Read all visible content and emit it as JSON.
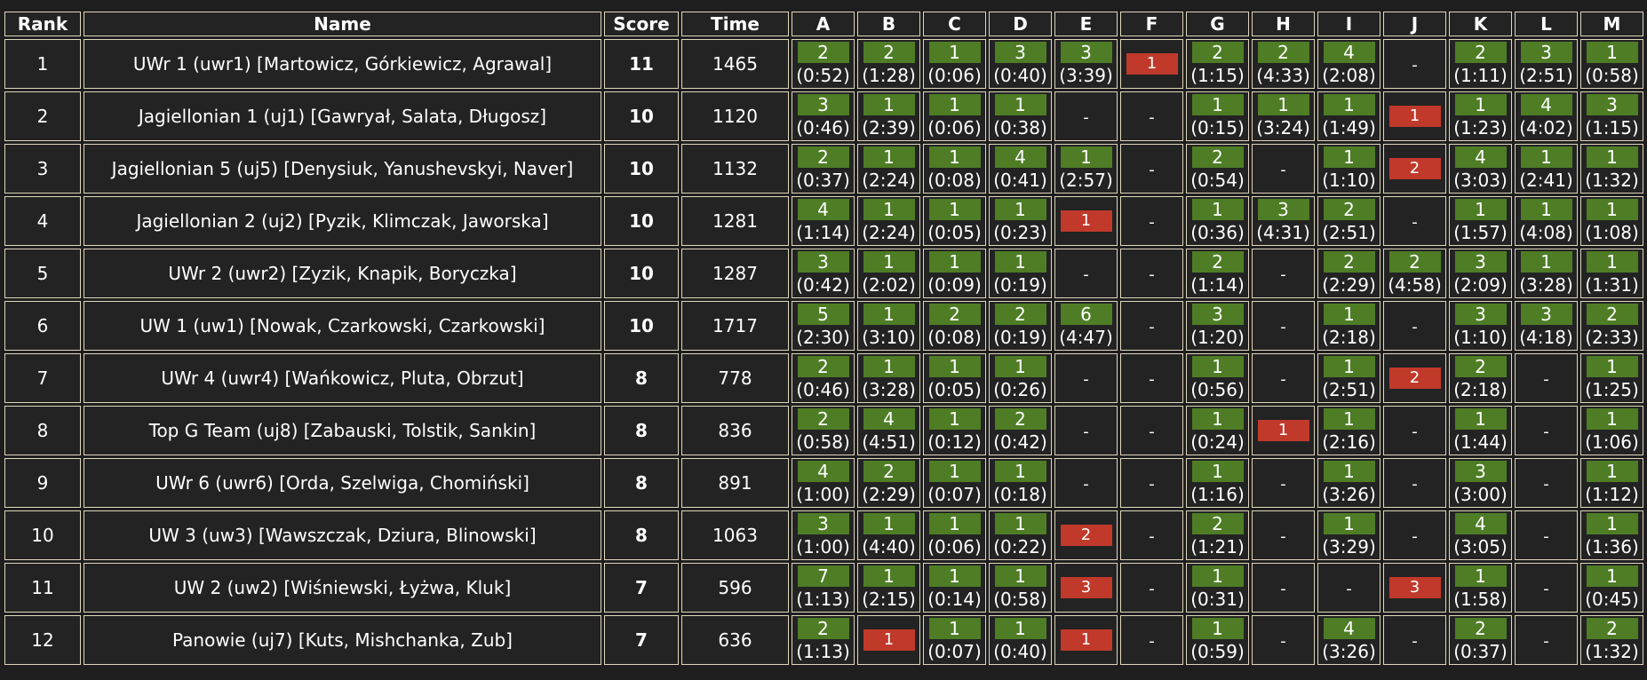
{
  "headers": {
    "rank": "Rank",
    "name": "Name",
    "score": "Score",
    "time": "Time",
    "problems": [
      "A",
      "B",
      "C",
      "D",
      "E",
      "F",
      "G",
      "H",
      "I",
      "J",
      "K",
      "L",
      "M"
    ]
  },
  "colors": {
    "solved": "#4e7d25",
    "failed": "#c0392b",
    "background": "#232323",
    "border": "#e0d6bd"
  },
  "rows": [
    {
      "rank": "1",
      "name": "UWr 1 (uwr1) [Martowicz, Górkiewicz, Agrawal]",
      "score": "11",
      "time": "1465",
      "cells": [
        {
          "s": "ok",
          "a": "2",
          "t": "(0:52)"
        },
        {
          "s": "ok",
          "a": "2",
          "t": "(1:28)"
        },
        {
          "s": "ok",
          "a": "1",
          "t": "(0:06)"
        },
        {
          "s": "ok",
          "a": "3",
          "t": "(0:40)"
        },
        {
          "s": "ok",
          "a": "3",
          "t": "(3:39)"
        },
        {
          "s": "fail",
          "a": "1"
        },
        {
          "s": "ok",
          "a": "2",
          "t": "(1:15)"
        },
        {
          "s": "ok",
          "a": "2",
          "t": "(4:33)"
        },
        {
          "s": "ok",
          "a": "4",
          "t": "(2:08)"
        },
        {
          "s": "none",
          "a": "-"
        },
        {
          "s": "ok",
          "a": "2",
          "t": "(1:11)"
        },
        {
          "s": "ok",
          "a": "3",
          "t": "(2:51)"
        },
        {
          "s": "ok",
          "a": "1",
          "t": "(0:58)"
        }
      ]
    },
    {
      "rank": "2",
      "name": "Jagiellonian 1 (uj1) [Gawryał, Salata, Długosz]",
      "score": "10",
      "time": "1120",
      "cells": [
        {
          "s": "ok",
          "a": "3",
          "t": "(0:46)"
        },
        {
          "s": "ok",
          "a": "1",
          "t": "(2:39)"
        },
        {
          "s": "ok",
          "a": "1",
          "t": "(0:06)"
        },
        {
          "s": "ok",
          "a": "1",
          "t": "(0:38)"
        },
        {
          "s": "none",
          "a": "-"
        },
        {
          "s": "none",
          "a": "-"
        },
        {
          "s": "ok",
          "a": "1",
          "t": "(0:15)"
        },
        {
          "s": "ok",
          "a": "1",
          "t": "(3:24)"
        },
        {
          "s": "ok",
          "a": "1",
          "t": "(1:49)"
        },
        {
          "s": "fail",
          "a": "1"
        },
        {
          "s": "ok",
          "a": "1",
          "t": "(1:23)"
        },
        {
          "s": "ok",
          "a": "4",
          "t": "(4:02)"
        },
        {
          "s": "ok",
          "a": "3",
          "t": "(1:15)"
        }
      ]
    },
    {
      "rank": "3",
      "name": "Jagiellonian 5 (uj5) [Denysiuk, Yanushevskyi, Naver]",
      "score": "10",
      "time": "1132",
      "cells": [
        {
          "s": "ok",
          "a": "2",
          "t": "(0:37)"
        },
        {
          "s": "ok",
          "a": "1",
          "t": "(2:24)"
        },
        {
          "s": "ok",
          "a": "1",
          "t": "(0:08)"
        },
        {
          "s": "ok",
          "a": "4",
          "t": "(0:41)"
        },
        {
          "s": "ok",
          "a": "1",
          "t": "(2:57)"
        },
        {
          "s": "none",
          "a": "-"
        },
        {
          "s": "ok",
          "a": "2",
          "t": "(0:54)"
        },
        {
          "s": "none",
          "a": "-"
        },
        {
          "s": "ok",
          "a": "1",
          "t": "(1:10)"
        },
        {
          "s": "fail",
          "a": "2"
        },
        {
          "s": "ok",
          "a": "4",
          "t": "(3:03)"
        },
        {
          "s": "ok",
          "a": "1",
          "t": "(2:41)"
        },
        {
          "s": "ok",
          "a": "1",
          "t": "(1:32)"
        }
      ]
    },
    {
      "rank": "4",
      "name": "Jagiellonian 2 (uj2) [Pyzik, Klimczak, Jaworska]",
      "score": "10",
      "time": "1281",
      "cells": [
        {
          "s": "ok",
          "a": "4",
          "t": "(1:14)"
        },
        {
          "s": "ok",
          "a": "1",
          "t": "(2:24)"
        },
        {
          "s": "ok",
          "a": "1",
          "t": "(0:05)"
        },
        {
          "s": "ok",
          "a": "1",
          "t": "(0:23)"
        },
        {
          "s": "fail",
          "a": "1"
        },
        {
          "s": "none",
          "a": "-"
        },
        {
          "s": "ok",
          "a": "1",
          "t": "(0:36)"
        },
        {
          "s": "ok",
          "a": "3",
          "t": "(4:31)"
        },
        {
          "s": "ok",
          "a": "2",
          "t": "(2:51)"
        },
        {
          "s": "none",
          "a": "-"
        },
        {
          "s": "ok",
          "a": "1",
          "t": "(1:57)"
        },
        {
          "s": "ok",
          "a": "1",
          "t": "(4:08)"
        },
        {
          "s": "ok",
          "a": "1",
          "t": "(1:08)"
        }
      ]
    },
    {
      "rank": "5",
      "name": "UWr 2 (uwr2) [Zyzik, Knapik, Boryczka]",
      "score": "10",
      "time": "1287",
      "cells": [
        {
          "s": "ok",
          "a": "3",
          "t": "(0:42)"
        },
        {
          "s": "ok",
          "a": "1",
          "t": "(2:02)"
        },
        {
          "s": "ok",
          "a": "1",
          "t": "(0:09)"
        },
        {
          "s": "ok",
          "a": "1",
          "t": "(0:19)"
        },
        {
          "s": "none",
          "a": "-"
        },
        {
          "s": "none",
          "a": "-"
        },
        {
          "s": "ok",
          "a": "2",
          "t": "(1:14)"
        },
        {
          "s": "none",
          "a": "-"
        },
        {
          "s": "ok",
          "a": "2",
          "t": "(2:29)"
        },
        {
          "s": "ok",
          "a": "2",
          "t": "(4:58)"
        },
        {
          "s": "ok",
          "a": "3",
          "t": "(2:09)"
        },
        {
          "s": "ok",
          "a": "1",
          "t": "(3:28)"
        },
        {
          "s": "ok",
          "a": "1",
          "t": "(1:31)"
        }
      ]
    },
    {
      "rank": "6",
      "name": "UW 1 (uw1) [Nowak, Czarkowski, Czarkowski]",
      "score": "10",
      "time": "1717",
      "cells": [
        {
          "s": "ok",
          "a": "5",
          "t": "(2:30)"
        },
        {
          "s": "ok",
          "a": "1",
          "t": "(3:10)"
        },
        {
          "s": "ok",
          "a": "2",
          "t": "(0:08)"
        },
        {
          "s": "ok",
          "a": "2",
          "t": "(0:19)"
        },
        {
          "s": "ok",
          "a": "6",
          "t": "(4:47)"
        },
        {
          "s": "none",
          "a": "-"
        },
        {
          "s": "ok",
          "a": "3",
          "t": "(1:20)"
        },
        {
          "s": "none",
          "a": "-"
        },
        {
          "s": "ok",
          "a": "1",
          "t": "(2:18)"
        },
        {
          "s": "none",
          "a": "-"
        },
        {
          "s": "ok",
          "a": "3",
          "t": "(1:10)"
        },
        {
          "s": "ok",
          "a": "3",
          "t": "(4:18)"
        },
        {
          "s": "ok",
          "a": "2",
          "t": "(2:33)"
        }
      ]
    },
    {
      "rank": "7",
      "name": "UWr 4 (uwr4) [Wańkowicz, Pluta, Obrzut]",
      "score": "8",
      "time": "778",
      "cells": [
        {
          "s": "ok",
          "a": "2",
          "t": "(0:46)"
        },
        {
          "s": "ok",
          "a": "1",
          "t": "(3:28)"
        },
        {
          "s": "ok",
          "a": "1",
          "t": "(0:05)"
        },
        {
          "s": "ok",
          "a": "1",
          "t": "(0:26)"
        },
        {
          "s": "none",
          "a": "-"
        },
        {
          "s": "none",
          "a": "-"
        },
        {
          "s": "ok",
          "a": "1",
          "t": "(0:56)"
        },
        {
          "s": "none",
          "a": "-"
        },
        {
          "s": "ok",
          "a": "1",
          "t": "(2:51)"
        },
        {
          "s": "fail",
          "a": "2"
        },
        {
          "s": "ok",
          "a": "2",
          "t": "(2:18)"
        },
        {
          "s": "none",
          "a": "-"
        },
        {
          "s": "ok",
          "a": "1",
          "t": "(1:25)"
        }
      ]
    },
    {
      "rank": "8",
      "name": "Top G Team (uj8) [Zabauski, Tolstik, Sankin]",
      "score": "8",
      "time": "836",
      "cells": [
        {
          "s": "ok",
          "a": "2",
          "t": "(0:58)"
        },
        {
          "s": "ok",
          "a": "4",
          "t": "(4:51)"
        },
        {
          "s": "ok",
          "a": "1",
          "t": "(0:12)"
        },
        {
          "s": "ok",
          "a": "2",
          "t": "(0:42)"
        },
        {
          "s": "none",
          "a": "-"
        },
        {
          "s": "none",
          "a": "-"
        },
        {
          "s": "ok",
          "a": "1",
          "t": "(0:24)"
        },
        {
          "s": "fail",
          "a": "1"
        },
        {
          "s": "ok",
          "a": "1",
          "t": "(2:16)"
        },
        {
          "s": "none",
          "a": "-"
        },
        {
          "s": "ok",
          "a": "1",
          "t": "(1:44)"
        },
        {
          "s": "none",
          "a": "-"
        },
        {
          "s": "ok",
          "a": "1",
          "t": "(1:06)"
        }
      ]
    },
    {
      "rank": "9",
      "name": "UWr 6 (uwr6) [Orda, Szelwiga, Chomiński]",
      "score": "8",
      "time": "891",
      "cells": [
        {
          "s": "ok",
          "a": "4",
          "t": "(1:00)"
        },
        {
          "s": "ok",
          "a": "2",
          "t": "(2:29)"
        },
        {
          "s": "ok",
          "a": "1",
          "t": "(0:07)"
        },
        {
          "s": "ok",
          "a": "1",
          "t": "(0:18)"
        },
        {
          "s": "none",
          "a": "-"
        },
        {
          "s": "none",
          "a": "-"
        },
        {
          "s": "ok",
          "a": "1",
          "t": "(1:16)"
        },
        {
          "s": "none",
          "a": "-"
        },
        {
          "s": "ok",
          "a": "1",
          "t": "(3:26)"
        },
        {
          "s": "none",
          "a": "-"
        },
        {
          "s": "ok",
          "a": "3",
          "t": "(3:00)"
        },
        {
          "s": "none",
          "a": "-"
        },
        {
          "s": "ok",
          "a": "1",
          "t": "(1:12)"
        }
      ]
    },
    {
      "rank": "10",
      "name": "UW 3 (uw3) [Wawszczak, Dziura, Blinowski]",
      "score": "8",
      "time": "1063",
      "cells": [
        {
          "s": "ok",
          "a": "3",
          "t": "(1:00)"
        },
        {
          "s": "ok",
          "a": "1",
          "t": "(4:40)"
        },
        {
          "s": "ok",
          "a": "1",
          "t": "(0:06)"
        },
        {
          "s": "ok",
          "a": "1",
          "t": "(0:22)"
        },
        {
          "s": "fail",
          "a": "2"
        },
        {
          "s": "none",
          "a": "-"
        },
        {
          "s": "ok",
          "a": "2",
          "t": "(1:21)"
        },
        {
          "s": "none",
          "a": "-"
        },
        {
          "s": "ok",
          "a": "1",
          "t": "(3:29)"
        },
        {
          "s": "none",
          "a": "-"
        },
        {
          "s": "ok",
          "a": "4",
          "t": "(3:05)"
        },
        {
          "s": "none",
          "a": "-"
        },
        {
          "s": "ok",
          "a": "1",
          "t": "(1:36)"
        }
      ]
    },
    {
      "rank": "11",
      "name": "UW 2 (uw2) [Wiśniewski, Łyżwa, Kluk]",
      "score": "7",
      "time": "596",
      "cells": [
        {
          "s": "ok",
          "a": "7",
          "t": "(1:13)"
        },
        {
          "s": "ok",
          "a": "1",
          "t": "(2:15)"
        },
        {
          "s": "ok",
          "a": "1",
          "t": "(0:14)"
        },
        {
          "s": "ok",
          "a": "1",
          "t": "(0:58)"
        },
        {
          "s": "fail",
          "a": "3"
        },
        {
          "s": "none",
          "a": "-"
        },
        {
          "s": "ok",
          "a": "1",
          "t": "(0:31)"
        },
        {
          "s": "none",
          "a": "-"
        },
        {
          "s": "none",
          "a": "-"
        },
        {
          "s": "fail",
          "a": "3"
        },
        {
          "s": "ok",
          "a": "1",
          "t": "(1:58)"
        },
        {
          "s": "none",
          "a": "-"
        },
        {
          "s": "ok",
          "a": "1",
          "t": "(0:45)"
        }
      ]
    },
    {
      "rank": "12",
      "name": "Panowie (uj7) [Kuts, Mishchanka, Zub]",
      "score": "7",
      "time": "636",
      "cells": [
        {
          "s": "ok",
          "a": "2",
          "t": "(1:13)"
        },
        {
          "s": "fail",
          "a": "1"
        },
        {
          "s": "ok",
          "a": "1",
          "t": "(0:07)"
        },
        {
          "s": "ok",
          "a": "1",
          "t": "(0:40)"
        },
        {
          "s": "fail",
          "a": "1"
        },
        {
          "s": "none",
          "a": "-"
        },
        {
          "s": "ok",
          "a": "1",
          "t": "(0:59)"
        },
        {
          "s": "none",
          "a": "-"
        },
        {
          "s": "ok",
          "a": "4",
          "t": "(3:26)"
        },
        {
          "s": "none",
          "a": "-"
        },
        {
          "s": "ok",
          "a": "2",
          "t": "(0:37)"
        },
        {
          "s": "none",
          "a": "-"
        },
        {
          "s": "ok",
          "a": "2",
          "t": "(1:32)"
        }
      ]
    }
  ]
}
